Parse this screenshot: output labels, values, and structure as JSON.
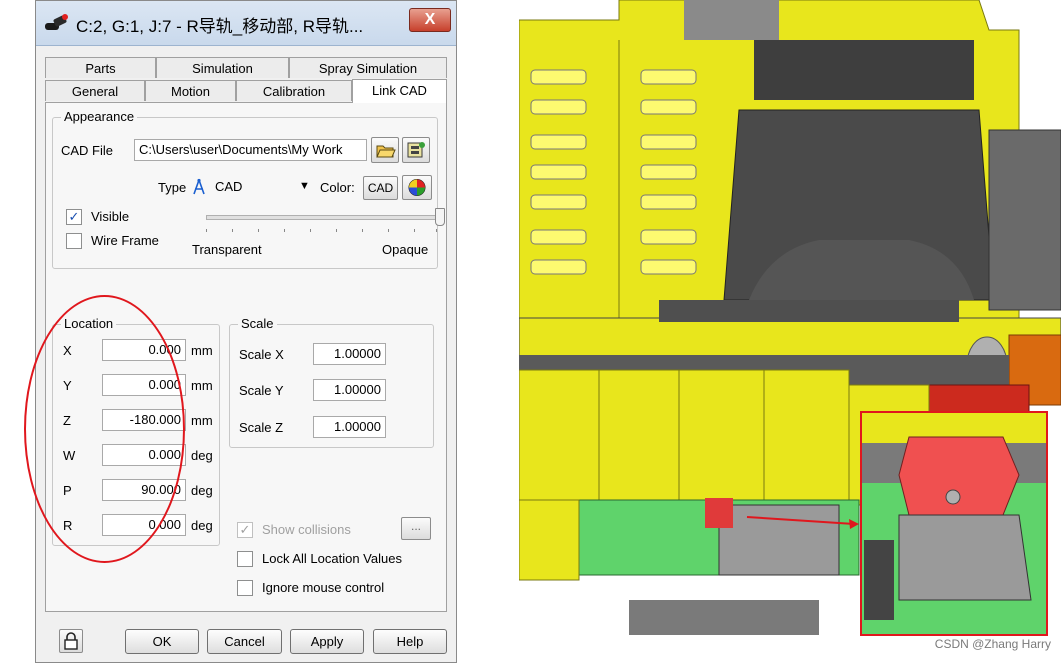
{
  "window": {
    "title": "C:2, G:1, J:7 - R导轨_移动部, R导轨...",
    "close_label": "X"
  },
  "tabs_row1": [
    "Parts",
    "Simulation",
    "Spray Simulation"
  ],
  "tabs_row2": [
    "General",
    "Motion",
    "Calibration",
    "Link CAD"
  ],
  "active_tab": "Link CAD",
  "appearance": {
    "group_title": "Appearance",
    "cad_file_label": "CAD File",
    "cad_file_value": "C:\\Users\\user\\Documents\\My Work",
    "type_label": "Type",
    "type_value": "CAD",
    "color_label": "Color:",
    "color_value": "CAD",
    "visible_label": "Visible",
    "visible_checked": true,
    "wire_frame_label": "Wire Frame",
    "wire_frame_checked": false,
    "slider_min_label": "Transparent",
    "slider_max_label": "Opaque",
    "opacity_level": 1.0
  },
  "location": {
    "group_title": "Location",
    "rows": [
      {
        "label": "X",
        "value": "0.000",
        "unit": "mm"
      },
      {
        "label": "Y",
        "value": "0.000",
        "unit": "mm"
      },
      {
        "label": "Z",
        "value": "-180.000",
        "unit": "mm"
      },
      {
        "label": "W",
        "value": "0.000",
        "unit": "deg"
      },
      {
        "label": "P",
        "value": "90.000",
        "unit": "deg"
      },
      {
        "label": "R",
        "value": "0.000",
        "unit": "deg"
      }
    ]
  },
  "scale": {
    "group_title": "Scale",
    "rows": [
      {
        "label": "Scale X",
        "value": "1.00000"
      },
      {
        "label": "Scale Y",
        "value": "1.00000"
      },
      {
        "label": "Scale Z",
        "value": "1.00000"
      }
    ]
  },
  "options": {
    "show_collisions_label": "Show collisions",
    "show_collisions_checked": true,
    "show_collisions_enabled": false,
    "more_button_label": "...",
    "lock_all_label": "Lock All Location Values",
    "lock_all_checked": false,
    "ignore_mouse_label": "Ignore mouse control",
    "ignore_mouse_checked": false
  },
  "buttons": {
    "ok": "OK",
    "cancel": "Cancel",
    "apply": "Apply",
    "help": "Help"
  },
  "watermark": "CSDN @Zhang Harry",
  "colors": {
    "robot_yellow": "#e8e61c",
    "robot_gray": "#5a5a5a",
    "robot_red": "#cc2a1e",
    "robot_green": "#5fd36b",
    "robot_orange": "#d96a10",
    "annotation_red": "#e0171d"
  }
}
